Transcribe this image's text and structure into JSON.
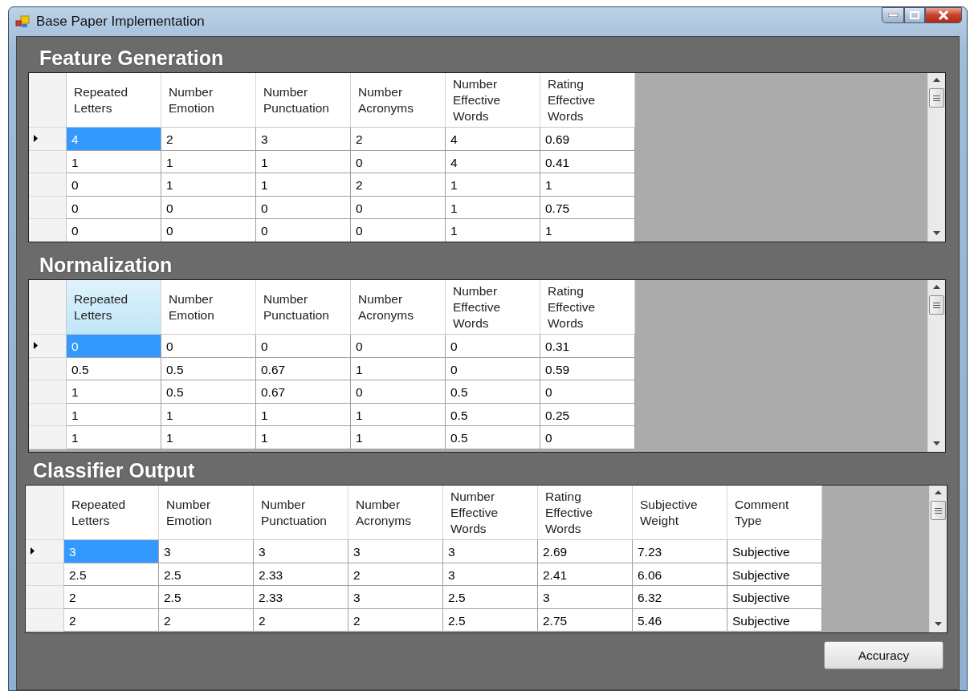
{
  "window": {
    "title": "Base Paper Implementation"
  },
  "sections": [
    {
      "title": "Feature Generation",
      "grid": {
        "columns": [
          {
            "label": "Repeated Letters",
            "selected": false
          },
          {
            "label": "Number Emotion",
            "selected": false
          },
          {
            "label": "Number Punctuation",
            "selected": false
          },
          {
            "label": "Number Acronyms",
            "selected": false
          },
          {
            "label": "Number Effective Words",
            "selected": false
          },
          {
            "label": "Rating Effective Words",
            "selected": false
          }
        ],
        "rows": [
          {
            "selected": true,
            "cells": [
              "4",
              "2",
              "3",
              "2",
              "4",
              "0.69"
            ]
          },
          {
            "selected": false,
            "cells": [
              "1",
              "1",
              "1",
              "0",
              "4",
              "0.41"
            ]
          },
          {
            "selected": false,
            "cells": [
              "0",
              "1",
              "1",
              "2",
              "1",
              "1"
            ]
          },
          {
            "selected": false,
            "cells": [
              "0",
              "0",
              "0",
              "0",
              "1",
              "0.75"
            ]
          },
          {
            "selected": false,
            "cells": [
              "0",
              "0",
              "0",
              "0",
              "1",
              "1"
            ]
          }
        ]
      }
    },
    {
      "title": "Normalization",
      "grid": {
        "columns": [
          {
            "label": "Repeated Letters",
            "selected": true
          },
          {
            "label": "Number Emotion",
            "selected": false
          },
          {
            "label": "Number Punctuation",
            "selected": false
          },
          {
            "label": "Number Acronyms",
            "selected": false
          },
          {
            "label": "Number Effective Words",
            "selected": false
          },
          {
            "label": "Rating Effective Words",
            "selected": false
          }
        ],
        "rows": [
          {
            "selected": true,
            "cells": [
              "0",
              "0",
              "0",
              "0",
              "0",
              "0.31"
            ]
          },
          {
            "selected": false,
            "cells": [
              "0.5",
              "0.5",
              "0.67",
              "1",
              "0",
              "0.59"
            ]
          },
          {
            "selected": false,
            "cells": [
              "1",
              "0.5",
              "0.67",
              "0",
              "0.5",
              "0"
            ]
          },
          {
            "selected": false,
            "cells": [
              "1",
              "1",
              "1",
              "1",
              "0.5",
              "0.25"
            ]
          },
          {
            "selected": false,
            "cells": [
              "1",
              "1",
              "1",
              "1",
              "0.5",
              "0"
            ]
          }
        ]
      }
    },
    {
      "title": "Classifier Output",
      "grid": {
        "columns": [
          {
            "label": "Repeated Letters",
            "selected": false
          },
          {
            "label": "Number Emotion",
            "selected": false
          },
          {
            "label": "Number Punctuation",
            "selected": false
          },
          {
            "label": "Number Acronyms",
            "selected": false
          },
          {
            "label": "Number Effective Words",
            "selected": false
          },
          {
            "label": "Rating Effective Words",
            "selected": false
          },
          {
            "label": "Subjective Weight",
            "selected": false
          },
          {
            "label": "Comment Type",
            "selected": false
          }
        ],
        "rows": [
          {
            "selected": true,
            "cells": [
              "3",
              "3",
              "3",
              "3",
              "3",
              "2.69",
              "7.23",
              "Subjective"
            ]
          },
          {
            "selected": false,
            "cells": [
              "2.5",
              "2.5",
              "2.33",
              "2",
              "3",
              "2.41",
              "6.06",
              "Subjective"
            ]
          },
          {
            "selected": false,
            "cells": [
              "2",
              "2.5",
              "2.33",
              "3",
              "2.5",
              "3",
              "6.32",
              "Subjective"
            ]
          },
          {
            "selected": false,
            "cells": [
              "2",
              "2",
              "2",
              "2",
              "2.5",
              "2.75",
              "5.46",
              "Subjective"
            ]
          }
        ]
      }
    }
  ],
  "buttons": [
    {
      "label": "Accuracy"
    }
  ]
}
